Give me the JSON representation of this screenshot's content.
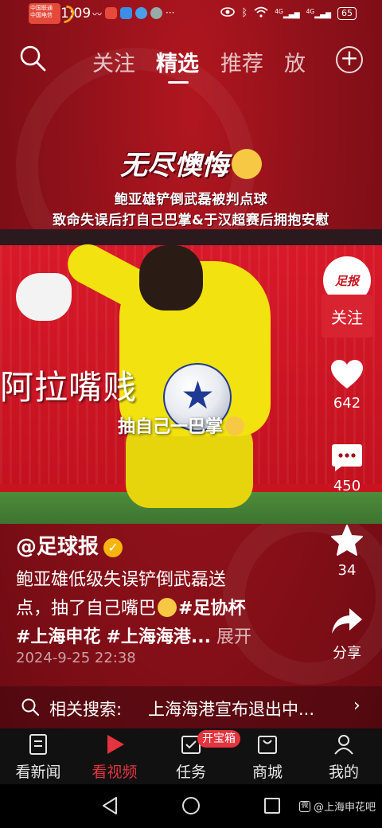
{
  "status_bar": {
    "carrier_lines": [
      "中国联通",
      "中国电信"
    ],
    "time": "1:09",
    "battery": "65",
    "signal_labels": [
      "4G",
      "4G"
    ]
  },
  "top_nav": {
    "tabs": [
      {
        "label": "关注"
      },
      {
        "label": "精选"
      },
      {
        "label": "推荐"
      },
      {
        "label": "放"
      }
    ],
    "active_tab": "精选"
  },
  "video": {
    "headline": "无尽懊悔",
    "subline_1": "鲍亚雄铲倒武磊被判点球",
    "subline_2": "致命失误后打自己巴掌&于汉超赛后拥抱安慰",
    "overlay_big": "阿拉嘴贱",
    "overlay_small": "抽自己一巴掌"
  },
  "side_actions": {
    "avatar_text": "足报",
    "follow_label": "关注",
    "like_count": "642",
    "comment_count": "450",
    "favorite_count": "34",
    "share_label": "分享"
  },
  "post": {
    "author": "@足球报",
    "desc_line1": "鲍亚雄低级失误铲倒武磊送",
    "desc_line2_text": "点，抽了自己嘴巴",
    "desc_line2_tag": "#足协杯",
    "desc_line3_tag1": "#上海申花",
    "desc_line3_tag2": "#上海海港...",
    "expand_label": "展开",
    "date": "2024-9-25 22:38"
  },
  "related_search": {
    "label": "相关搜索:",
    "query": "上海海港宣布退出中..."
  },
  "bottom_nav": {
    "items": [
      {
        "label": "看新闻"
      },
      {
        "label": "看视频"
      },
      {
        "label": "任务"
      },
      {
        "label": "商城"
      },
      {
        "label": "我的"
      }
    ],
    "badge": "开宝箱",
    "active": "看视频"
  },
  "watermark": "@上海申花吧",
  "colors": {
    "accent_red": "#e3343f",
    "bg_red": "#8f111a",
    "jersey_yellow": "#f2e20f"
  }
}
